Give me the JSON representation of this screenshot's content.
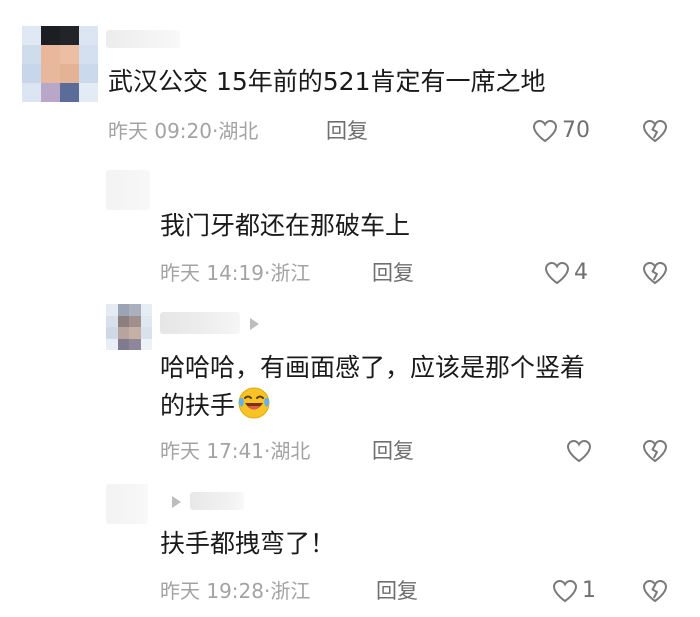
{
  "colors": {
    "text": "#1a1a1a",
    "meta": "#a3a3a3",
    "action": "#6f6f6f",
    "emoji_yellow": "#f7c325"
  },
  "comments": [
    {
      "text": "武汉公交  15年前的521肯定有一席之地",
      "time": "昨天 09:20",
      "location": "湖北",
      "reply_label": "回复",
      "like_count": "70"
    },
    {
      "text": "我门牙都还在那破车上",
      "time": "昨天 14:19",
      "location": "浙江",
      "reply_label": "回复",
      "like_count": "4"
    },
    {
      "text_line1": "哈哈哈，有画面感了，应该是那个竖着",
      "text_line2": "的扶手",
      "emoji": "laughing-crying-emoji",
      "time": "昨天 17:41",
      "location": "湖北",
      "reply_label": "回复",
      "like_count": ""
    },
    {
      "text": "扶手都拽弯了！",
      "time": "昨天 19:28",
      "location": "浙江",
      "reply_label": "回复",
      "like_count": "1"
    }
  ],
  "icons": {
    "like": "heart-outline-icon",
    "dislike": "broken-heart-icon",
    "reply_indicator": "play-triangle-icon"
  }
}
